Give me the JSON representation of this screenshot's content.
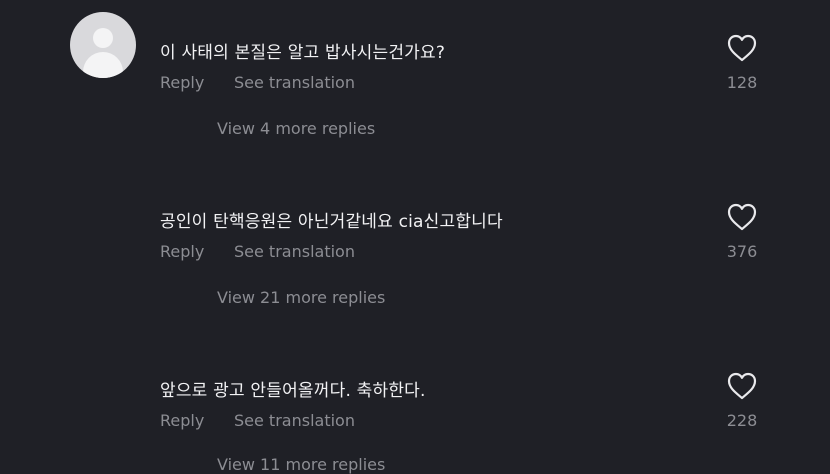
{
  "comments": [
    {
      "text": "이 사태의 본질은 알고 밥사시는건가요?",
      "reply_label": "Reply",
      "translate_label": "See translation",
      "replies_label": "View 4 more replies",
      "likes": "128",
      "has_avatar": true
    },
    {
      "text": "공인이 탄핵응원은 아닌거같네요 cia신고합니다",
      "reply_label": "Reply",
      "translate_label": "See translation",
      "replies_label": "View 21 more replies",
      "likes": "376",
      "has_avatar": false
    },
    {
      "text": "앞으로 광고 안들어올꺼다. 축하한다.",
      "reply_label": "Reply",
      "translate_label": "See translation",
      "replies_label": "View 11 more replies",
      "likes": "228",
      "has_avatar": false
    }
  ],
  "icons": {
    "avatar": "default-user-avatar-icon",
    "like": "heart-outline-icon"
  }
}
